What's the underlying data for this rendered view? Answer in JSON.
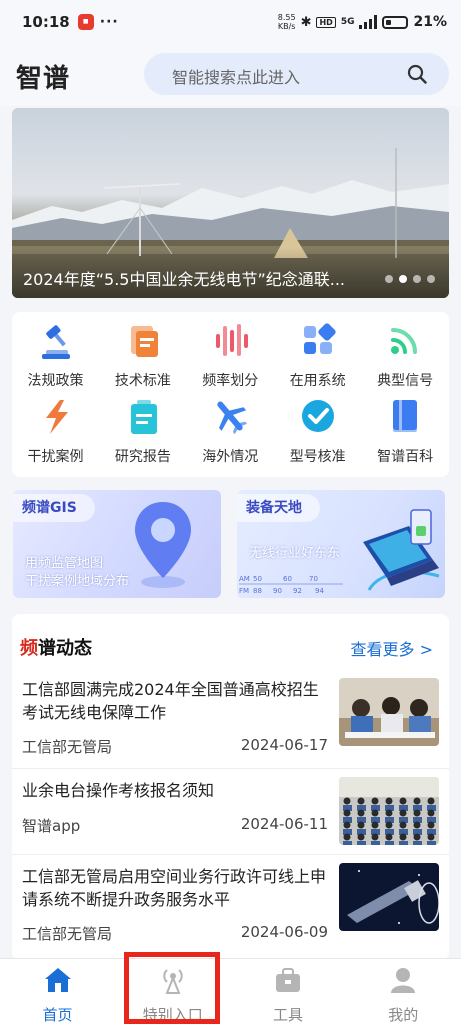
{
  "status_bar": {
    "time": "10:18",
    "speed": "8.55",
    "speed_unit": "KB/s",
    "hd": "HD",
    "network": "5G",
    "battery_pct": "21%"
  },
  "header": {
    "title": "智谱",
    "search_placeholder": "智能搜索点此进入"
  },
  "banner": {
    "caption": "2024年度“5.5中国业余无线电节”纪念通联...",
    "slide_count": 4,
    "active_slide": 1
  },
  "functions": [
    {
      "label": "法规政策",
      "icon": "gavel-icon",
      "color": "#2d6fe0"
    },
    {
      "label": "技术标准",
      "icon": "document-stack-icon",
      "color": "#f0823a"
    },
    {
      "label": "频率划分",
      "icon": "waveform-icon",
      "color": "#ec5a6a"
    },
    {
      "label": "在用系统",
      "icon": "app-grid-icon",
      "color": "#3b7cf0"
    },
    {
      "label": "典型信号",
      "icon": "signal-wave-icon",
      "color": "#2fcf8a"
    },
    {
      "label": "干扰案例",
      "icon": "lightning-icon",
      "color": "#f07a3c"
    },
    {
      "label": "研究报告",
      "icon": "clipboard-icon",
      "color": "#27c3d9"
    },
    {
      "label": "海外情况",
      "icon": "airplane-icon",
      "color": "#3b82f0"
    },
    {
      "label": "型号核准",
      "icon": "check-circle-icon",
      "color": "#1aa7e0"
    },
    {
      "label": "智谱百科",
      "icon": "book-icon",
      "color": "#3b7cf0"
    }
  ],
  "cards": {
    "gis": {
      "tag": "频谱GIS",
      "line1": "用频监管地图",
      "line2": "干扰案例地域分布"
    },
    "equipment": {
      "tag": "装备天地",
      "line1": "无线行业好东东",
      "scale_am": "AM",
      "scale_fm": "FM",
      "am_ticks": [
        "50",
        "60",
        "70"
      ],
      "fm_ticks": [
        "88",
        "90",
        "92",
        "94"
      ]
    }
  },
  "news": {
    "title_red": "频",
    "title_rest": "谱动态",
    "more": "查看更多 >",
    "items": [
      {
        "title": "工信部圆满完成2024年全国普通高校招生考试无线电保障工作",
        "source": "工信部无管局",
        "date": "2024-06-17",
        "thumb": "exam-classroom"
      },
      {
        "title": "业余电台操作考核报名须知",
        "source": "智谱app",
        "date": "2024-06-11",
        "thumb": "exam-hall"
      },
      {
        "title": "工信部无管局启用空间业务行政许可线上申请系统不断提升政务服务水平",
        "source": "工信部无管局",
        "date": "2024-06-09",
        "thumb": "satellite"
      }
    ]
  },
  "bottom_nav": [
    {
      "label": "首页",
      "icon": "home-icon",
      "active": true
    },
    {
      "label": "特别入口",
      "icon": "broadcast-icon",
      "active": false
    },
    {
      "label": "工具",
      "icon": "toolbox-icon",
      "active": false
    },
    {
      "label": "我的",
      "icon": "user-icon",
      "active": false
    }
  ],
  "colors": {
    "accent": "#1a6fd6",
    "highlight": "#e8261c"
  }
}
